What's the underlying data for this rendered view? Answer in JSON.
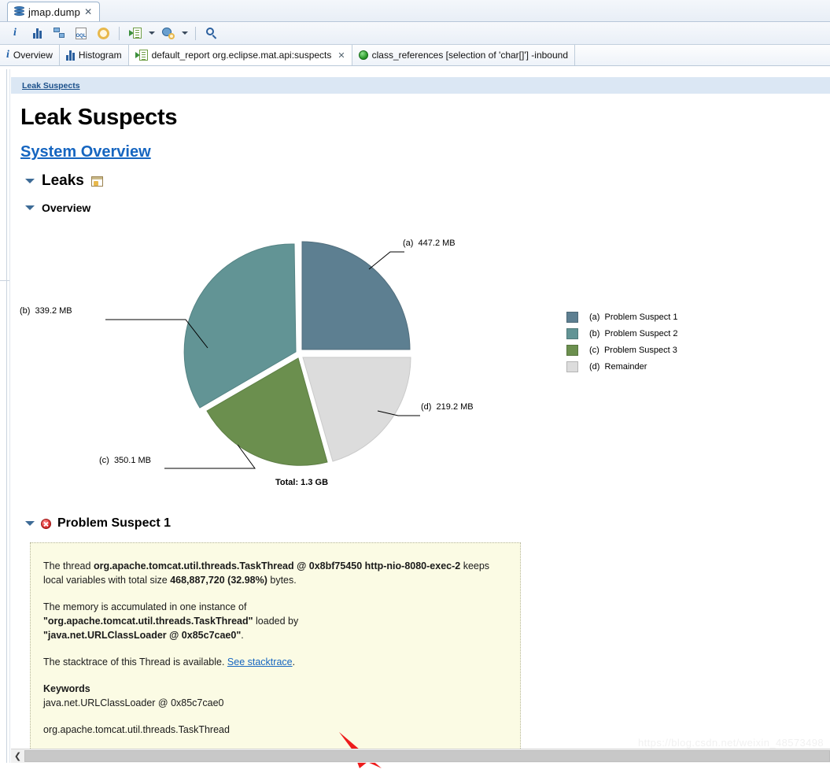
{
  "window": {
    "editor_tab": {
      "title": "jmap.dump",
      "icon": "database-icon",
      "close": "✕"
    }
  },
  "toolbar": {
    "buttons": [
      {
        "name": "info-icon",
        "tooltip": "Overview"
      },
      {
        "name": "histogram-icon",
        "tooltip": "Histogram"
      },
      {
        "name": "dominator-tree-icon",
        "tooltip": "Dominator Tree"
      },
      {
        "name": "oql-icon",
        "label": "OQL",
        "tooltip": "OQL Studio"
      },
      {
        "name": "gear-icon",
        "tooltip": "Run Expert System Test"
      },
      {
        "name": "query-browser-icon",
        "tooltip": "Open Query Browser"
      },
      {
        "name": "inspect-icon",
        "tooltip": "Inspect"
      },
      {
        "name": "search-icon",
        "tooltip": "Find"
      }
    ]
  },
  "view_tabs": [
    {
      "label": "Overview",
      "icon": "info-icon",
      "active": false,
      "closable": false
    },
    {
      "label": "Histogram",
      "icon": "histogram-icon",
      "active": false,
      "closable": false
    },
    {
      "label": "default_report  org.eclipse.mat.api:suspects",
      "icon": "report-icon",
      "active": true,
      "closable": true,
      "close": "✕"
    },
    {
      "label": "class_references  [selection of 'char[]'] -inbound",
      "icon": "green-ball-icon",
      "active": false,
      "closable": false
    }
  ],
  "breadcrumb": {
    "label": "Leak Suspects"
  },
  "page": {
    "title": "Leak Suspects",
    "system_overview_link": "System Overview",
    "sections": [
      {
        "label": "Leaks",
        "icon": "window-icon"
      },
      {
        "label": "Overview"
      }
    ]
  },
  "chart_data": {
    "type": "pie",
    "title": "",
    "total_label": "Total: 1.3 GB",
    "total_value": "1.3 GB",
    "slices": [
      {
        "key": "(a)",
        "legend": "(a)  Problem Suspect 1",
        "callout": "(a)  447.2 MB",
        "value_mb": 447.2,
        "color": "#5d7f91"
      },
      {
        "key": "(b)",
        "legend": "(b)  Problem Suspect 2",
        "callout": "(b)  339.2 MB",
        "value_mb": 339.2,
        "color": "#629495"
      },
      {
        "key": "(c)",
        "legend": "(c)  Problem Suspect 3",
        "callout": "(c)  350.1 MB",
        "value_mb": 350.1,
        "color": "#6b8f4e"
      },
      {
        "key": "(d)",
        "legend": "(d)  Remainder",
        "callout": "(d)  219.2 MB",
        "value_mb": 219.2,
        "color": "#dcdcdc"
      }
    ],
    "legend_position": "right",
    "grid": false
  },
  "suspect": {
    "title": "Problem Suspect 1",
    "status_icon": "error-icon",
    "para1_pre": "The thread ",
    "para1_b1": "org.apache.tomcat.util.threads.TaskThread @ 0x8bf75450 http-nio-8080-exec-2",
    "para1_mid": " keeps local variables with total size ",
    "para1_b2": "468,887,720 (32.98%)",
    "para1_post": " bytes.",
    "para2_pre": "The memory is accumulated in one instance of ",
    "para2_b1": "\"org.apache.tomcat.util.threads.TaskThread\"",
    "para2_mid": " loaded by ",
    "para2_b2": "\"java.net.URLClassLoader @ 0x85c7cae0\"",
    "para2_post": ".",
    "para3_pre": "The stacktrace of this Thread is available. ",
    "para3_link": "See stacktrace",
    "para3_post": ".",
    "keywords_title": "Keywords",
    "keywords": [
      "java.net.URLClassLoader @ 0x85c7cae0",
      "org.apache.tomcat.util.threads.TaskThread"
    ]
  },
  "scrollbar": {
    "left_arrow": "❮"
  },
  "watermark": "https://blog.csdn.net/weixin_48573498",
  "colors": {
    "accent_link": "#1565c0",
    "breadcrumb_bg": "#dbe7f4",
    "note_bg": "#fbfbe4",
    "arrow": "#ee1c1c"
  }
}
